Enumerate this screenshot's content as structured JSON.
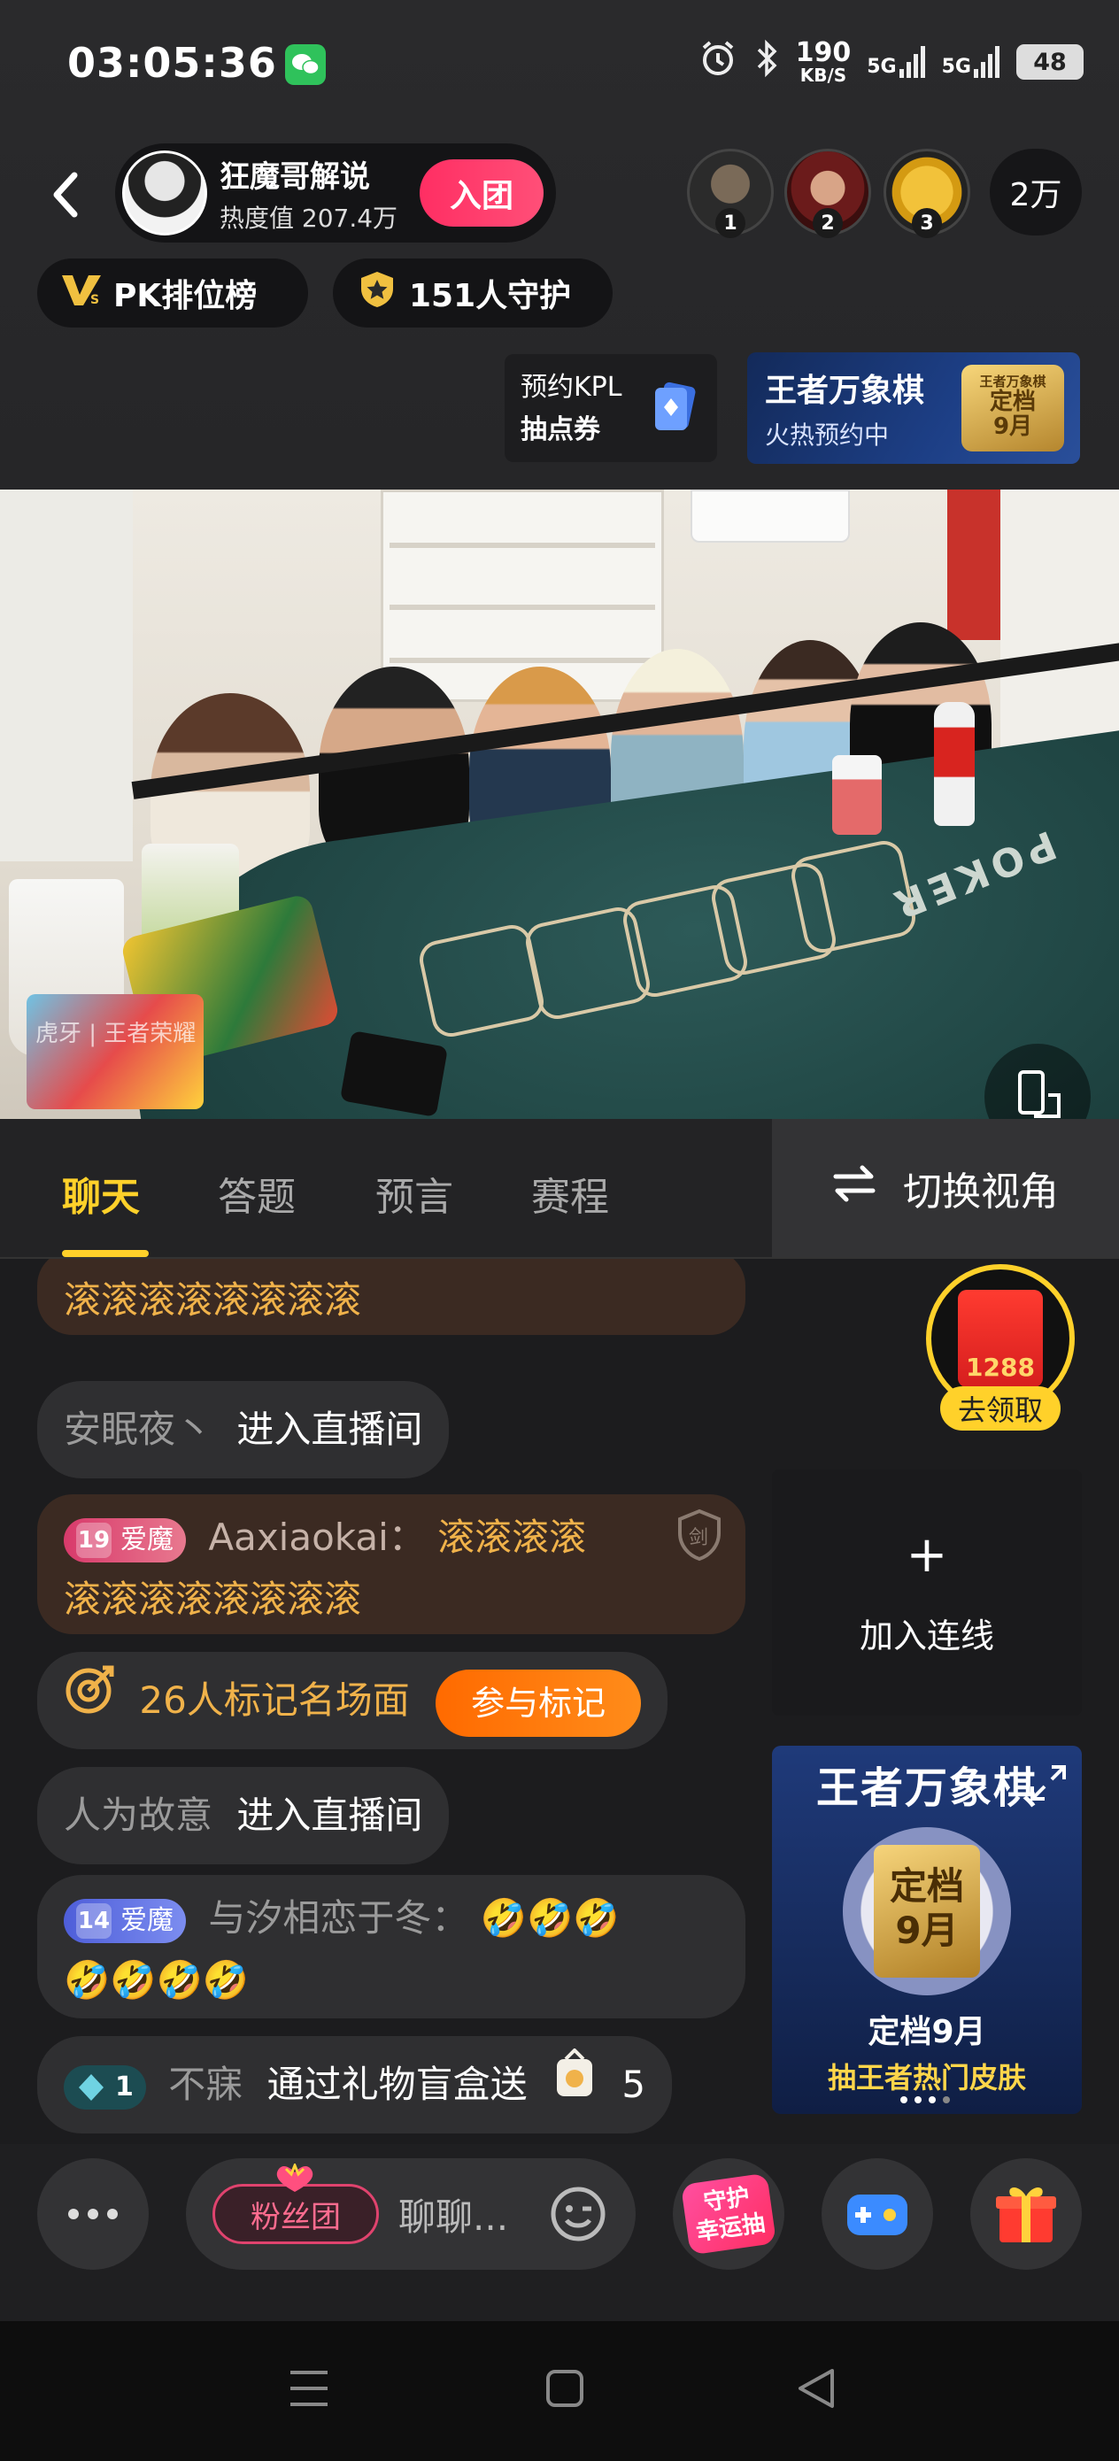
{
  "status": {
    "time": "03:05:36",
    "net_speed_value": "190",
    "net_speed_unit": "KB/S",
    "signal1": "5G",
    "signal2": "5G",
    "battery": "48"
  },
  "header": {
    "host_name": "狂魔哥解说",
    "heat_label": "热度值 207.4万",
    "join_label": "入团",
    "ranks": [
      "1",
      "2",
      "3"
    ],
    "viewer_count": "2万",
    "pk_label": "PK排位榜",
    "guard_label": "151人守护"
  },
  "promos": {
    "kpl_line1": "预约KPL",
    "kpl_line2": "抽点券",
    "game_title": "王者万象棋",
    "game_sub": "火热预约中",
    "seal_top": "王者万象棋",
    "seal_main1": "定档",
    "seal_main2": "9月"
  },
  "video": {
    "watermark_line1": "虎牙 | 王者荣耀",
    "table_text": "POKER"
  },
  "tabs": {
    "items": [
      "聊天",
      "答题",
      "预言",
      "赛程"
    ],
    "switch_view": "切换视角"
  },
  "chat": {
    "msg0": "滚滚滚滚滚滚滚滚",
    "msg1_user": "安眠夜丶",
    "msg1_action": "进入直播间",
    "msg2_level": "19",
    "msg2_fan": "爱魔",
    "msg2_user": "Aaxiaokai：",
    "msg2_text1": "滚滚滚滚",
    "msg2_text2": "滚滚滚滚滚滚滚滚",
    "msg3_text": "26人标记名场面",
    "msg3_btn": "参与标记",
    "msg4_user": "人为故意",
    "msg4_action": "进入直播间",
    "msg5_level": "14",
    "msg5_fan": "爱魔",
    "msg5_user": "与汐相恋于冬：",
    "msg5_emoji1": "🤣🤣🤣",
    "msg5_emoji2": "🤣🤣🤣🤣",
    "msg6_level": "1",
    "msg6_user": "不寐",
    "msg6_action": "通过礼物盲盒送",
    "msg6_count": "5"
  },
  "side": {
    "redpacket_amount": "1288",
    "redpacket_label": "去领取",
    "join_line_plus": "+",
    "join_line_label": "加入连线",
    "card_title": "王者万象棋",
    "card_seal1": "定档",
    "card_seal2": "9月",
    "card_line1": "定档9月",
    "card_line2": "抽王者热门皮肤"
  },
  "bottom": {
    "fan_club": "粉丝团",
    "input_placeholder": "聊聊...",
    "guard_lottery1": "守护",
    "guard_lottery2": "幸运抽"
  },
  "colors": {
    "accent_yellow": "#ffd12a",
    "pink": "#ff2e63",
    "orange": "#ff7a0a",
    "gold_text": "#f0b24a"
  }
}
